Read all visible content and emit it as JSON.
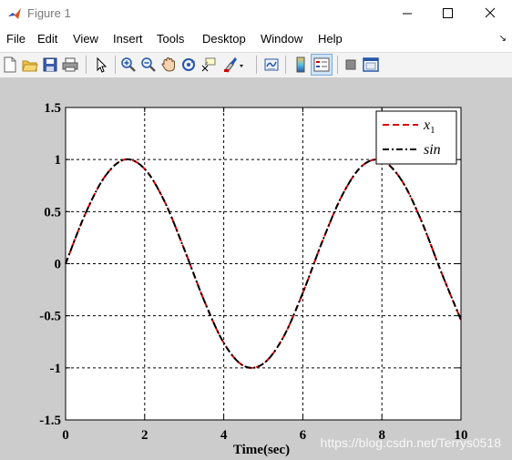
{
  "window": {
    "title": "Figure 1",
    "controls": [
      "minimize",
      "maximize",
      "close"
    ]
  },
  "menu": {
    "items": [
      "File",
      "Edit",
      "View",
      "Insert",
      "Tools",
      "Desktop",
      "Window",
      "Help"
    ],
    "overflow_glyph": "↘"
  },
  "toolbar": {
    "buttons": [
      "new-figure-icon",
      "open-file-icon",
      "save-icon",
      "print-icon",
      "pointer-icon",
      "zoom-in-icon",
      "zoom-out-icon",
      "pan-hand-icon",
      "rotate-3d-icon",
      "data-cursor-icon",
      "brush-icon",
      "link-plot-icon",
      "colorbar-icon",
      "legend-icon",
      "hide-plot-tools-icon",
      "show-plot-tools-icon"
    ]
  },
  "watermark": "https://blog.csdn.net/Terrys0518",
  "chart_data": {
    "type": "line",
    "title": "",
    "xlabel": "Time(sec)",
    "ylabel": "",
    "xlim": [
      0,
      10
    ],
    "ylim": [
      -1.5,
      1.5
    ],
    "xticks": [
      "0",
      "2",
      "4",
      "6",
      "8",
      "10"
    ],
    "yticks": [
      "1.5",
      "1",
      "0.5",
      "0",
      "-0.5",
      "-1",
      "-1.5"
    ],
    "grid": true,
    "legend_position": "top-right",
    "series": [
      {
        "name": "x_1",
        "legend_label": "x1",
        "color": "#e00000",
        "style": "dashed",
        "x": [
          0,
          0.5,
          1,
          1.5,
          2,
          2.5,
          3,
          3.5,
          4,
          4.5,
          5,
          5.5,
          6,
          6.5,
          7,
          7.5,
          8,
          8.5,
          9,
          9.5,
          10
        ],
        "y": [
          0,
          0.48,
          0.84,
          1.0,
          0.91,
          0.6,
          0.14,
          -0.35,
          -0.76,
          -0.98,
          -0.96,
          -0.71,
          -0.28,
          0.22,
          0.66,
          0.94,
          0.99,
          0.8,
          0.41,
          -0.08,
          -0.54
        ]
      },
      {
        "name": "sin",
        "legend_label": "sin",
        "color": "#000000",
        "style": "dashdot",
        "x": [
          0,
          0.5,
          1,
          1.5,
          2,
          2.5,
          3,
          3.5,
          4,
          4.5,
          5,
          5.5,
          6,
          6.5,
          7,
          7.5,
          8,
          8.5,
          9,
          9.5,
          10
        ],
        "y": [
          0,
          0.48,
          0.84,
          1.0,
          0.91,
          0.6,
          0.14,
          -0.35,
          -0.76,
          -0.98,
          -0.96,
          -0.71,
          -0.28,
          0.22,
          0.66,
          0.94,
          0.99,
          0.8,
          0.41,
          -0.08,
          -0.54
        ]
      }
    ]
  }
}
